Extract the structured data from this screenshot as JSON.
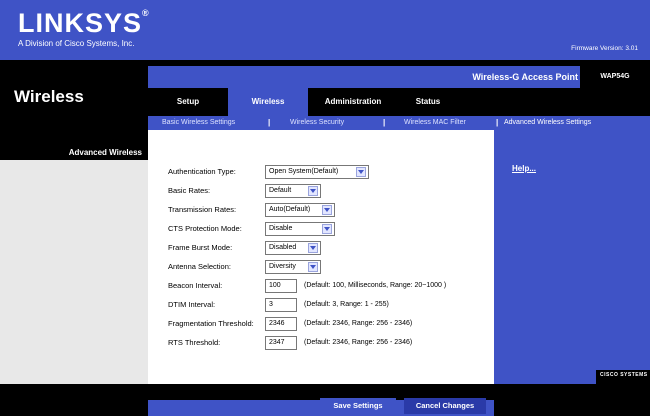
{
  "header": {
    "logo": "LINKSYS",
    "logo_sub": "A Division of Cisco Systems, Inc.",
    "firmware": "Firmware Version: 3.01",
    "product_name": "Wireless-G Access Point",
    "model": "WAP54G",
    "section_title": "Wireless"
  },
  "tabs": [
    {
      "label": "Setup",
      "active": false
    },
    {
      "label": "Wireless",
      "active": true
    },
    {
      "label": "Administration",
      "active": false
    },
    {
      "label": "Status",
      "active": false
    }
  ],
  "subnav": [
    {
      "label": "Basic Wireless Settings"
    },
    {
      "label": "Wireless Security"
    },
    {
      "label": "Wireless MAC Filter"
    },
    {
      "label": "Advanced Wireless Settings"
    }
  ],
  "left_panel": {
    "heading": "Advanced Wireless"
  },
  "settings": {
    "auth_type": {
      "label": "Authentication Type:",
      "value": "Open System(Default)"
    },
    "basic_rates": {
      "label": "Basic Rates:",
      "value": "Default"
    },
    "transmission_rates": {
      "label": "Transmission Rates:",
      "value": "Auto(Default)"
    },
    "cts_protection": {
      "label": "CTS Protection Mode:",
      "value": "Disable"
    },
    "frame_burst": {
      "label": "Frame Burst Mode:",
      "value": "Disabled"
    },
    "antenna": {
      "label": "Antenna Selection:",
      "value": "Diversity"
    },
    "beacon": {
      "label": "Beacon Interval:",
      "value": "100",
      "hint": "(Default: 100, Milliseconds, Range: 20~1000 )"
    },
    "dtim": {
      "label": "DTIM Interval:",
      "value": "3",
      "hint": "(Default: 3, Range: 1 - 255)"
    },
    "fragmentation": {
      "label": "Fragmentation Threshold:",
      "value": "2346",
      "hint": "(Default: 2346, Range: 256 - 2346)"
    },
    "rts": {
      "label": "RTS Threshold:",
      "value": "2347",
      "hint": "(Default: 2346, Range: 256 - 2346)"
    }
  },
  "help": {
    "link": "Help..."
  },
  "cisco": {
    "text": "CISCO SYSTEMS"
  },
  "buttons": {
    "save": "Save Settings",
    "cancel": "Cancel Changes"
  },
  "colors": {
    "brand_blue": "#3f53c6",
    "black": "#000000"
  }
}
